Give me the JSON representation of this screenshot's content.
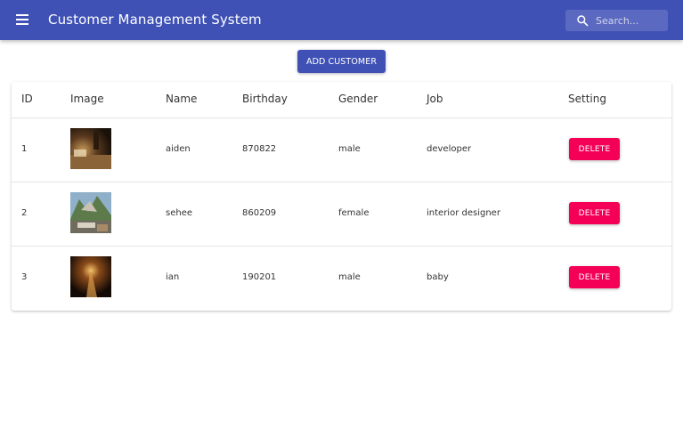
{
  "app": {
    "title": "Customer Management System",
    "search_placeholder": "Search...",
    "menu_icon": "hamburger-menu-icon",
    "search_icon": "search-icon",
    "primary_color": "#3f51b5",
    "danger_color": "#f50057"
  },
  "toolbar": {
    "add_label": "ADD CUSTOMER"
  },
  "table": {
    "headers": {
      "id": "ID",
      "image": "Image",
      "name": "Name",
      "birthday": "Birthday",
      "gender": "Gender",
      "job": "Job",
      "setting": "Setting"
    },
    "rows": [
      {
        "id": "1",
        "name": "aiden",
        "birthday": "870822",
        "gender": "male",
        "job": "developer",
        "action": "DELETE",
        "image": "photo of a desk with a lamp"
      },
      {
        "id": "2",
        "name": "sehee",
        "birthday": "860209",
        "gender": "female",
        "job": "interior designer",
        "action": "DELETE",
        "image": "photo of mountain landscape"
      },
      {
        "id": "3",
        "name": "ian",
        "birthday": "190201",
        "gender": "male",
        "job": "baby",
        "action": "DELETE",
        "image": "photo of a lit tunnel path"
      }
    ]
  }
}
